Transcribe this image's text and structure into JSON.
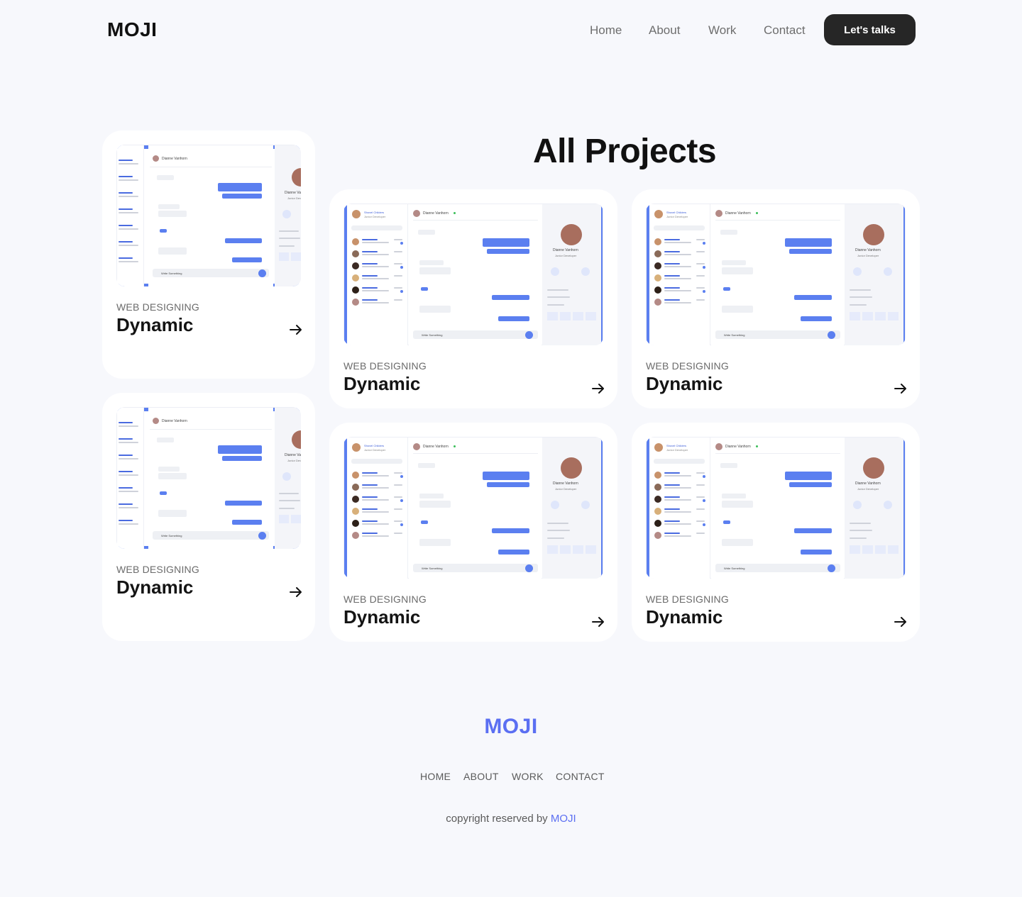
{
  "brand": {
    "logo": "MOJI"
  },
  "nav": {
    "home": "Home",
    "about": "About",
    "work": "Work",
    "contact": "Contact"
  },
  "cta": "Let's talks",
  "page_title": "All Projects",
  "card_category": "WEB DESIGNING",
  "card_title": "Dynamic",
  "mock": {
    "contact_name": "Dianne Vanhorn",
    "profile_name": "Dianne Vanhorn",
    "profile_role": "Junior Developer",
    "sidebar_name": "Shovel Childers",
    "sidebar_role": "Junior Developer",
    "compose": "Write Something"
  },
  "footer": {
    "logo": "MOJI",
    "nav": {
      "home": "HOME",
      "about": "ABOUT",
      "work": "WORK",
      "contact": "CONTACT"
    },
    "copyright": "copyright reserved by",
    "copyright_brand": "MOJI"
  },
  "colors": {
    "accent": "#5b6ff2",
    "mock_blue": "#5b7ff0",
    "cta_bg": "#262626",
    "background": "#f7f8fc"
  },
  "icons": {
    "arrow": "arrow-right-icon"
  }
}
